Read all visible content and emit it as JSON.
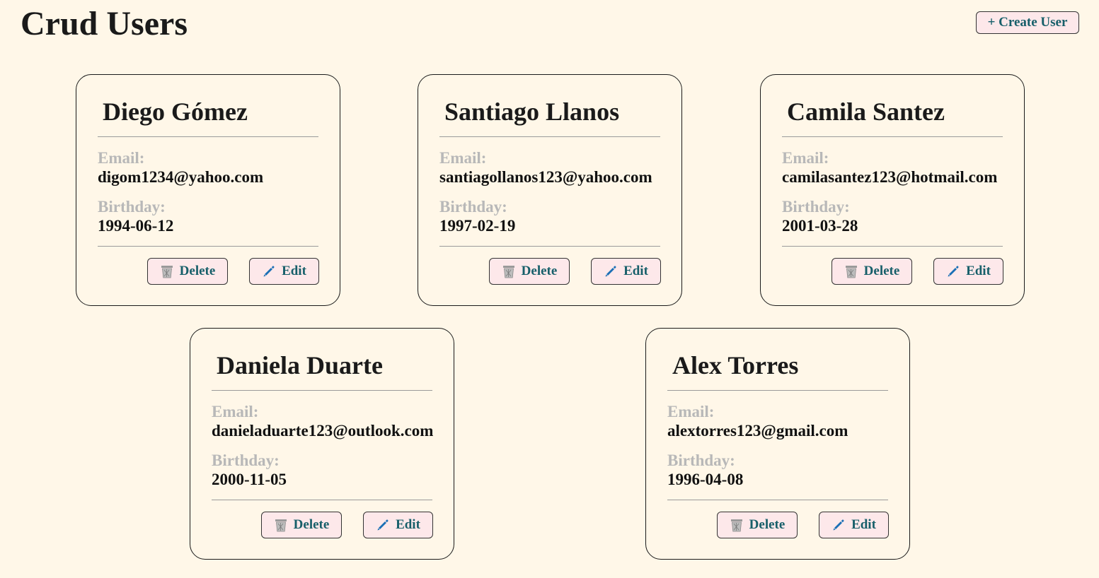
{
  "header": {
    "title": "Crud Users",
    "create_label": "+ Create User"
  },
  "labels": {
    "email": "Email:",
    "birthday": "Birthday:",
    "delete": "Delete",
    "edit": "Edit"
  },
  "users": [
    {
      "name": "Diego Gómez",
      "email": "digom1234@yahoo.com",
      "birthday": "1994-06-12"
    },
    {
      "name": "Santiago Llanos",
      "email": "santiagollanos123@yahoo.com",
      "birthday": "1997-02-19"
    },
    {
      "name": "Camila Santez",
      "email": "camilasantez123@hotmail.com",
      "birthday": "2001-03-28"
    },
    {
      "name": "Daniela Duarte",
      "email": "danieladuarte123@outlook.com",
      "birthday": "2000-11-05"
    },
    {
      "name": "Alex Torres",
      "email": "alextorres123@gmail.com",
      "birthday": "1996-04-08"
    }
  ],
  "colors": {
    "background": "#fff7e8",
    "button_bg": "#fde8ea",
    "button_text": "#175f6a",
    "label": "#b8b8b8",
    "edit_icon": "#1a6fb5",
    "delete_icon": "#9a9a9a"
  },
  "icons": {
    "delete": "trash-can-icon",
    "edit": "pencil-icon"
  }
}
